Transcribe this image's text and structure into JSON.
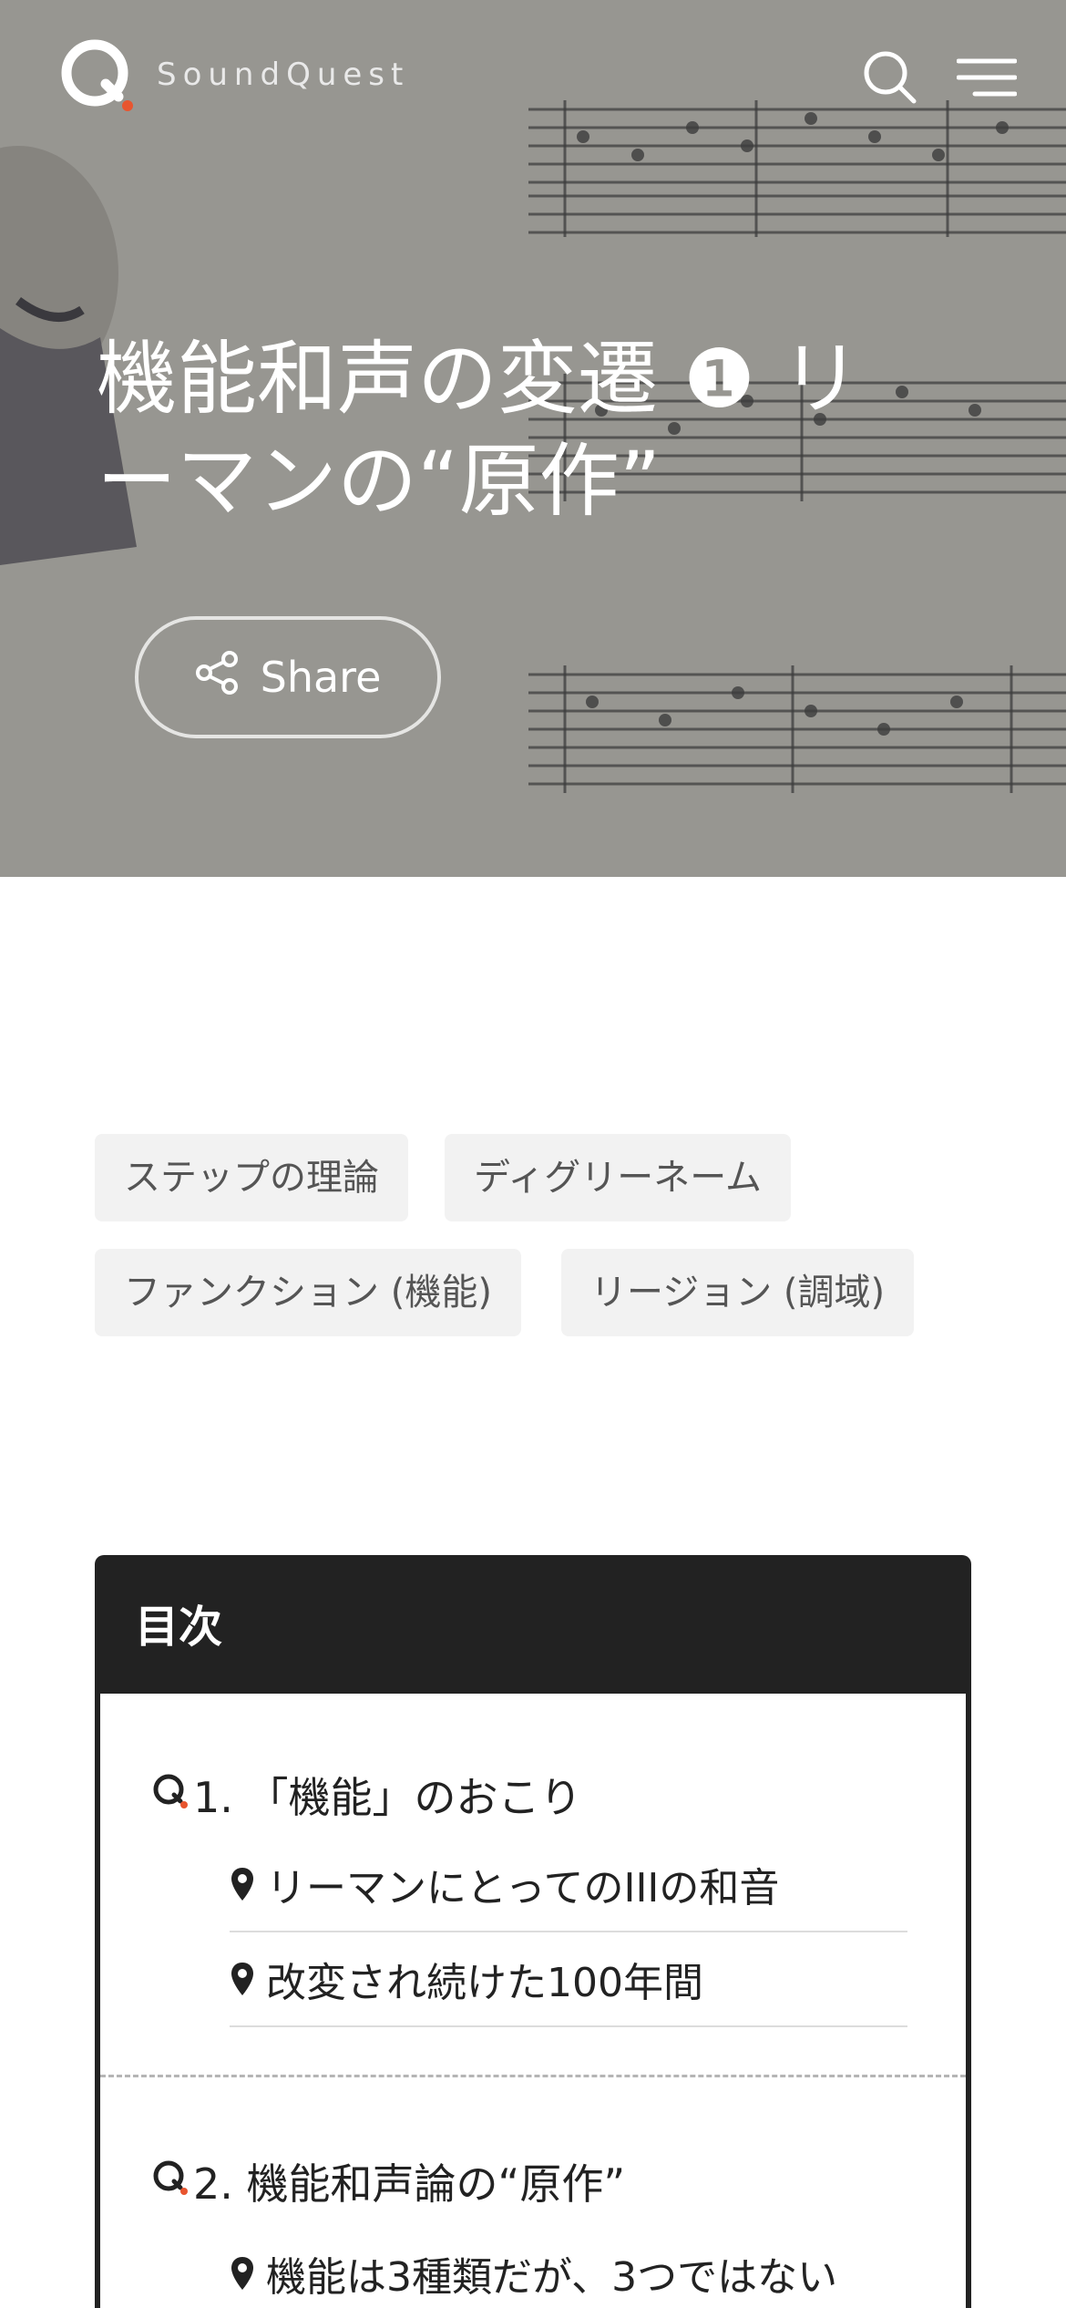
{
  "header": {
    "logo_text": "SoundQuest",
    "icons": [
      "search-icon",
      "menu-icon"
    ]
  },
  "hero": {
    "title": "機能和声の変遷 ❶ リーマンの“原作”",
    "share_label": "Share"
  },
  "tags": [
    "ステップの理論",
    "ディグリーネーム",
    "ファンクション (機能)",
    "リージョン (調域)"
  ],
  "toc": {
    "title": "目次",
    "sections": [
      {
        "heading": "1. 「機能」のおこり",
        "items": [
          "リーマンにとってのIIIの和音",
          "改変され続けた100年間"
        ]
      },
      {
        "heading": "2. 機能和声論の“原作”",
        "items": [
          "機能は3種類だが、3つではない"
        ]
      }
    ]
  },
  "colors": {
    "accent": "#e8552f",
    "toc_header": "#222222",
    "tag_bg": "#f2f2f2"
  }
}
